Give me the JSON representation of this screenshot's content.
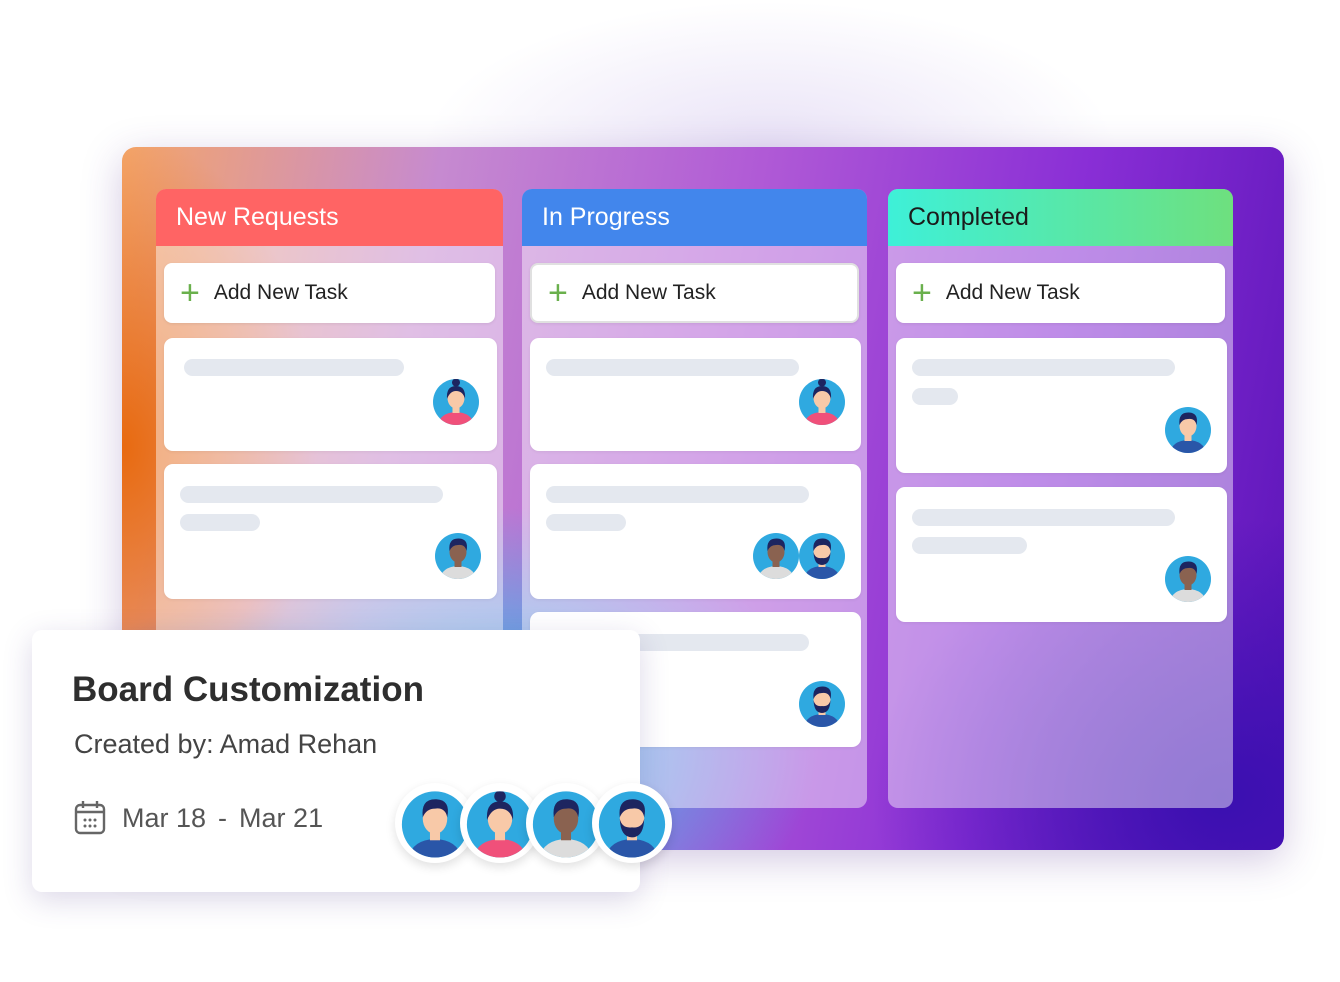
{
  "columns": [
    {
      "title": "New Requests",
      "color": "#ff6464",
      "text": "#ffffff",
      "add_label": "Add New Task",
      "cards": [
        {
          "avatars": [
            "woman-avatar"
          ]
        },
        {
          "avatars": [
            "dark-man-avatar"
          ]
        }
      ]
    },
    {
      "title": "In Progress",
      "color": "#4286ec",
      "text": "#ffffff",
      "add_label": "Add New Task",
      "cards": [
        {
          "avatars": [
            "woman-avatar"
          ]
        },
        {
          "avatars": [
            "dark-man-avatar",
            "bearded-man-avatar"
          ]
        },
        {
          "avatars": [
            "bearded-man-avatar"
          ]
        }
      ]
    },
    {
      "title": "Completed",
      "color": "#4ef0c8",
      "text": "#1b1b1b",
      "add_label": "Add New Task",
      "cards": [
        {
          "avatars": [
            "man-avatar"
          ]
        },
        {
          "avatars": [
            "dark-man-avatar"
          ]
        }
      ]
    }
  ],
  "detail_card": {
    "title": "Board Customization",
    "created_by": "Created by: Amad Rehan",
    "start_date": "Mar 18",
    "separator": "-",
    "end_date": "Mar 21",
    "members": [
      "man-avatar",
      "woman-avatar",
      "dark-man-avatar",
      "bearded-man-avatar"
    ]
  }
}
